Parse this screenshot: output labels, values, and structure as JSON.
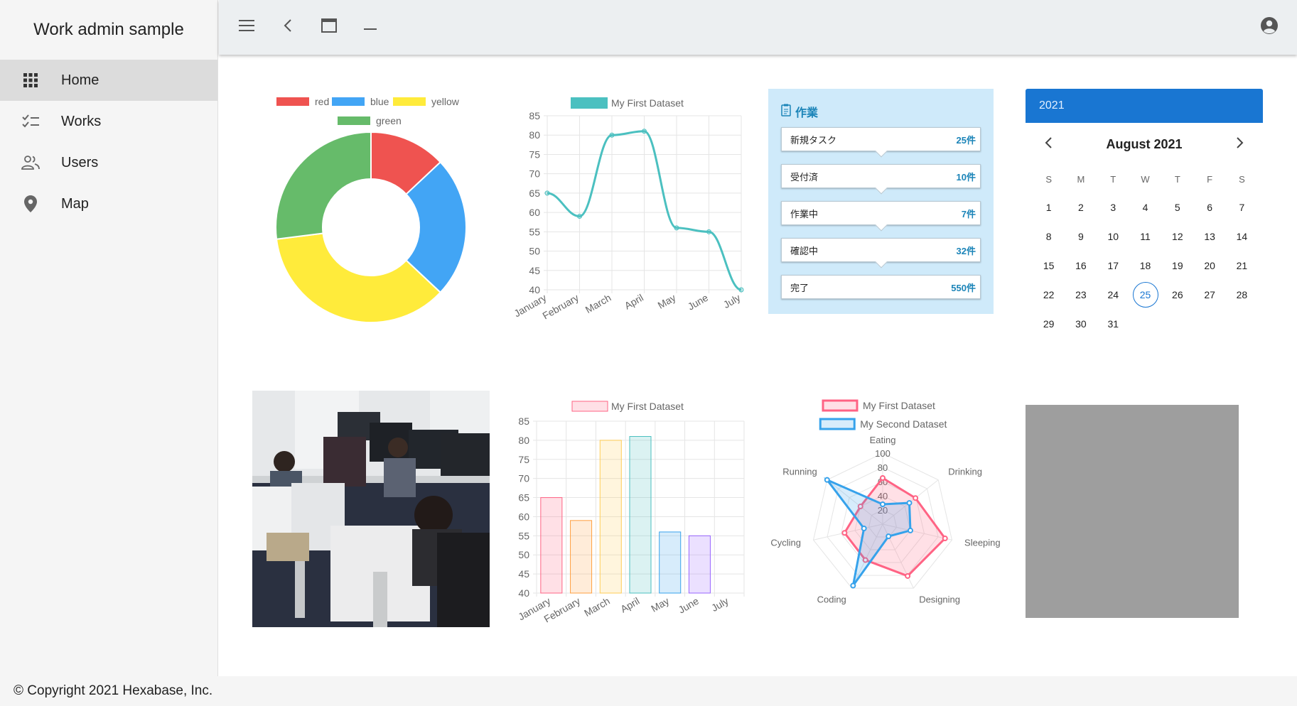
{
  "app": {
    "title": "Work admin sample"
  },
  "sidebar": {
    "items": [
      {
        "label": "Home",
        "icon": "apps-icon"
      },
      {
        "label": "Works",
        "icon": "checklist-icon"
      },
      {
        "label": "Users",
        "icon": "people-icon"
      },
      {
        "label": "Map",
        "icon": "map-pin-icon"
      }
    ]
  },
  "toolbar": {
    "icons": [
      "menu-icon",
      "chevron-left-icon",
      "window-icon",
      "minimize-icon",
      "account-icon"
    ]
  },
  "footer": {
    "text": "© Copyright 2021 Hexabase, Inc."
  },
  "tasks": {
    "title": "作業",
    "items": [
      {
        "label": "新規タスク",
        "count": "25件"
      },
      {
        "label": "受付済",
        "count": "10件"
      },
      {
        "label": "作業中",
        "count": "7件"
      },
      {
        "label": "確認中",
        "count": "32件"
      },
      {
        "label": "完了",
        "count": "550件"
      }
    ]
  },
  "calendar": {
    "year": "2021",
    "month": "August 2021",
    "weekdays": [
      "S",
      "M",
      "T",
      "W",
      "T",
      "F",
      "S"
    ],
    "days": [
      "1",
      "2",
      "3",
      "4",
      "5",
      "6",
      "7",
      "8",
      "9",
      "10",
      "11",
      "12",
      "13",
      "14",
      "15",
      "16",
      "17",
      "18",
      "19",
      "20",
      "21",
      "22",
      "23",
      "24",
      "25",
      "26",
      "27",
      "28",
      "29",
      "30",
      "31"
    ],
    "today": "25"
  },
  "chart_data": [
    {
      "type": "pie",
      "variant": "doughnut",
      "categories": [
        "red",
        "blue",
        "yellow",
        "green"
      ],
      "values": [
        13,
        24,
        36,
        27
      ],
      "colors": [
        "#ef5350",
        "#42a5f5",
        "#ffeb3b",
        "#66bb6a"
      ],
      "legend": "top"
    },
    {
      "type": "line",
      "categories": [
        "January",
        "February",
        "March",
        "April",
        "May",
        "June",
        "July"
      ],
      "series": [
        {
          "name": "My First Dataset",
          "values": [
            65,
            59,
            80,
            81,
            56,
            55,
            40
          ],
          "color": "#4bc0c0"
        }
      ],
      "ylim": [
        40,
        85
      ],
      "yticks": [
        40,
        45,
        50,
        55,
        60,
        65,
        70,
        75,
        80,
        85
      ],
      "grid": true,
      "legend": "top"
    },
    {
      "type": "bar",
      "categories": [
        "January",
        "February",
        "March",
        "April",
        "May",
        "June",
        "July"
      ],
      "series": [
        {
          "name": "My First Dataset",
          "values": [
            65,
            59,
            80,
            81,
            56,
            55,
            40
          ]
        }
      ],
      "colors": [
        "#ff6384",
        "#ff9f40",
        "#ffcd56",
        "#4bc0c0",
        "#36a2eb",
        "#9966ff",
        "#c9cbcf"
      ],
      "ylim": [
        40,
        85
      ],
      "yticks": [
        40,
        45,
        50,
        55,
        60,
        65,
        70,
        75,
        80,
        85
      ],
      "grid": true,
      "legend": "top"
    },
    {
      "type": "radar",
      "categories": [
        "Eating",
        "Drinking",
        "Sleeping",
        "Designing",
        "Coding",
        "Cycling",
        "Running"
      ],
      "series": [
        {
          "name": "My First Dataset",
          "values": [
            65,
            59,
            90,
            81,
            56,
            55,
            40
          ],
          "color": "#ff6384"
        },
        {
          "name": "My Second Dataset",
          "values": [
            28,
            48,
            40,
            19,
            96,
            27,
            100
          ],
          "color": "#36a2eb"
        }
      ],
      "ticks": [
        20,
        40,
        60,
        80,
        100
      ],
      "legend": "top"
    }
  ]
}
